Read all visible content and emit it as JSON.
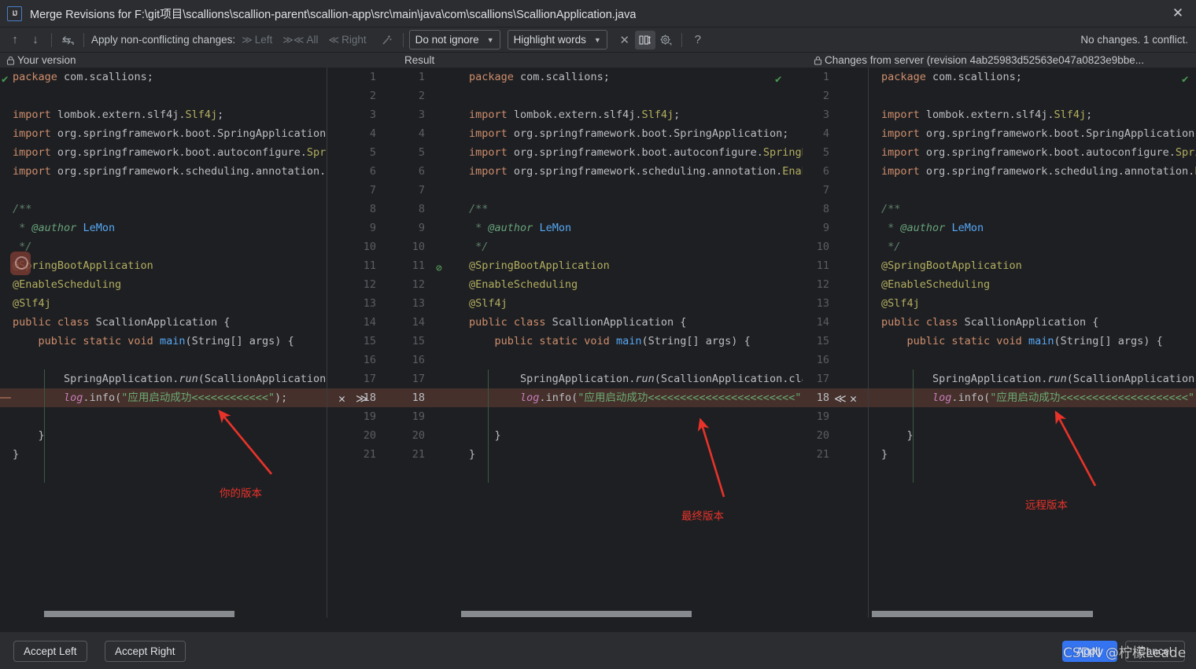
{
  "window": {
    "title": "Merge Revisions for F:\\git项目\\scallions\\scallion-parent\\scallion-app\\src\\main\\java\\com\\scallions\\ScallionApplication.java",
    "logo_text": "IJ",
    "close_icon": "✕"
  },
  "toolbar": {
    "prev_icon": "↑",
    "next_icon": "↓",
    "resolve_icon": "⇄",
    "apply_label": "Apply non-conflicting changes:",
    "left_label": "Left",
    "all_label": "All",
    "right_label": "Right",
    "magic_icon": "magic-wand",
    "ignore_policy": "Do not ignore",
    "highlight_policy": "Highlight words",
    "collapse_icon": "✕",
    "columns_icon": "columns",
    "settings_icon": "gear",
    "help_icon": "?",
    "caret": "▼",
    "status": "No changes. 1 conflict."
  },
  "panes": {
    "left_title": "Your version",
    "center_title": "Result",
    "right_title": "Changes from server (revision 4ab25983d52563e047a0823e9bbe...",
    "lock_glyph": "🔒"
  },
  "code": {
    "left_lines": [
      {
        "n": 1,
        "tokens": [
          [
            "kw",
            "package"
          ],
          [
            "id",
            " com.scallions"
          ],
          [
            "pun",
            ";"
          ]
        ]
      },
      {
        "n": 2,
        "tokens": []
      },
      {
        "n": 3,
        "tokens": [
          [
            "kw",
            "import"
          ],
          [
            "id",
            " lombok.extern.slf4j."
          ],
          [
            "ann",
            "Slf4j"
          ],
          [
            "pun",
            ";"
          ]
        ]
      },
      {
        "n": 4,
        "tokens": [
          [
            "kw",
            "import"
          ],
          [
            "id",
            " org.springframework.boot.SpringApplication"
          ],
          [
            "pun",
            ";"
          ]
        ]
      },
      {
        "n": 5,
        "tokens": [
          [
            "kw",
            "import"
          ],
          [
            "id",
            " org.springframework.boot.autoconfigure."
          ],
          [
            "ann",
            "Spri"
          ]
        ]
      },
      {
        "n": 6,
        "tokens": [
          [
            "kw",
            "import"
          ],
          [
            "id",
            " org.springframework.scheduling.annotation."
          ],
          [
            "ann",
            "E"
          ]
        ]
      },
      {
        "n": 7,
        "tokens": []
      },
      {
        "n": 8,
        "tokens": [
          [
            "doc",
            "/**"
          ]
        ]
      },
      {
        "n": 9,
        "tokens": [
          [
            "doc",
            " * "
          ],
          [
            "tag",
            "@author"
          ],
          [
            "doc",
            " "
          ],
          [
            "fn",
            "LeMon"
          ]
        ]
      },
      {
        "n": 10,
        "tokens": [
          [
            "doc",
            " */"
          ]
        ]
      },
      {
        "n": 11,
        "tokens": [
          [
            "ann",
            "@SpringBootApplication"
          ]
        ]
      },
      {
        "n": 12,
        "tokens": [
          [
            "ann",
            "@EnableScheduling"
          ]
        ]
      },
      {
        "n": 13,
        "tokens": [
          [
            "ann",
            "@Slf4j"
          ]
        ]
      },
      {
        "n": 14,
        "tokens": [
          [
            "kw",
            "public class "
          ],
          [
            "id",
            "ScallionApplication "
          ],
          [
            "brc",
            "{"
          ]
        ]
      },
      {
        "n": 15,
        "tokens": [
          [
            "id",
            "    "
          ],
          [
            "kw",
            "public static void "
          ],
          [
            "fn",
            "main"
          ],
          [
            "pun",
            "("
          ],
          [
            "id",
            "String"
          ],
          [
            "brc",
            "[]"
          ],
          [
            "id",
            " args"
          ],
          [
            "pun",
            ") "
          ],
          [
            "brc",
            "{"
          ]
        ]
      },
      {
        "n": 16,
        "tokens": []
      },
      {
        "n": 17,
        "tokens": [
          [
            "id",
            "        SpringApplication."
          ],
          [
            "mth",
            "run"
          ],
          [
            "pun",
            "("
          ],
          [
            "id",
            "ScallionApplication."
          ]
        ]
      },
      {
        "n": 18,
        "tokens": [
          [
            "id",
            "        "
          ],
          [
            "fld",
            "log"
          ],
          [
            "pun",
            "."
          ],
          [
            "id",
            "info"
          ],
          [
            "pun",
            "("
          ],
          [
            "str",
            "\"应用启动成功<<<<<<<<<<<<\""
          ],
          [
            "pun",
            ");"
          ]
        ],
        "conflict": true
      },
      {
        "n": 19,
        "tokens": []
      },
      {
        "n": 20,
        "tokens": [
          [
            "id",
            "    "
          ],
          [
            "brc",
            "}"
          ]
        ]
      },
      {
        "n": 21,
        "tokens": [
          [
            "brc",
            "}"
          ]
        ]
      }
    ],
    "center_lines": [
      {
        "n": 1,
        "tokens": [
          [
            "kw",
            "package"
          ],
          [
            "id",
            " com.scallions"
          ],
          [
            "pun",
            ";"
          ]
        ]
      },
      {
        "n": 2,
        "tokens": []
      },
      {
        "n": 3,
        "tokens": [
          [
            "kw",
            "import"
          ],
          [
            "id",
            " lombok.extern.slf4j."
          ],
          [
            "ann",
            "Slf4j"
          ],
          [
            "pun",
            ";"
          ]
        ]
      },
      {
        "n": 4,
        "tokens": [
          [
            "kw",
            "import"
          ],
          [
            "id",
            " org.springframework.boot.SpringApplication"
          ],
          [
            "pun",
            ";"
          ]
        ]
      },
      {
        "n": 5,
        "tokens": [
          [
            "kw",
            "import"
          ],
          [
            "id",
            " org.springframework.boot.autoconfigure."
          ],
          [
            "ann",
            "SpringB"
          ]
        ]
      },
      {
        "n": 6,
        "tokens": [
          [
            "kw",
            "import"
          ],
          [
            "id",
            " org.springframework.scheduling.annotation."
          ],
          [
            "ann",
            "Enab"
          ]
        ]
      },
      {
        "n": 7,
        "tokens": []
      },
      {
        "n": 8,
        "tokens": [
          [
            "doc",
            "/**"
          ]
        ]
      },
      {
        "n": 9,
        "tokens": [
          [
            "doc",
            " * "
          ],
          [
            "tag",
            "@author"
          ],
          [
            "doc",
            " "
          ],
          [
            "fn",
            "LeMon"
          ]
        ]
      },
      {
        "n": 10,
        "tokens": [
          [
            "doc",
            " */"
          ]
        ]
      },
      {
        "n": 11,
        "tokens": [
          [
            "ann",
            "@SpringBootApplication"
          ]
        ]
      },
      {
        "n": 12,
        "tokens": [
          [
            "ann",
            "@EnableScheduling"
          ]
        ]
      },
      {
        "n": 13,
        "tokens": [
          [
            "ann",
            "@Slf4j"
          ]
        ]
      },
      {
        "n": 14,
        "tokens": [
          [
            "kw",
            "public class "
          ],
          [
            "id",
            "ScallionApplication "
          ],
          [
            "brc",
            "{"
          ]
        ]
      },
      {
        "n": 15,
        "tokens": [
          [
            "id",
            "    "
          ],
          [
            "kw",
            "public static void "
          ],
          [
            "fn",
            "main"
          ],
          [
            "pun",
            "("
          ],
          [
            "id",
            "String"
          ],
          [
            "brc",
            "[]"
          ],
          [
            "id",
            " args"
          ],
          [
            "pun",
            ") "
          ],
          [
            "brc",
            "{"
          ]
        ]
      },
      {
        "n": 16,
        "tokens": []
      },
      {
        "n": 17,
        "tokens": [
          [
            "id",
            "        SpringApplication."
          ],
          [
            "mth",
            "run"
          ],
          [
            "pun",
            "("
          ],
          [
            "id",
            "ScallionApplication.cla"
          ]
        ]
      },
      {
        "n": 18,
        "tokens": [
          [
            "id",
            "        "
          ],
          [
            "fld",
            "log"
          ],
          [
            "pun",
            "."
          ],
          [
            "id",
            "info"
          ],
          [
            "pun",
            "("
          ],
          [
            "str",
            "\"应用启动成功<<<<<<<<<<<<<<<<<<<<<<<\""
          ]
        ],
        "conflict": true
      },
      {
        "n": 19,
        "tokens": []
      },
      {
        "n": 20,
        "tokens": [
          [
            "id",
            "    "
          ],
          [
            "brc",
            "}"
          ]
        ]
      },
      {
        "n": 21,
        "tokens": [
          [
            "brc",
            "}"
          ]
        ]
      }
    ],
    "right_lines": [
      {
        "n": 1,
        "tokens": [
          [
            "kw",
            "package"
          ],
          [
            "id",
            " com.scallions"
          ],
          [
            "pun",
            ";"
          ]
        ]
      },
      {
        "n": 2,
        "tokens": []
      },
      {
        "n": 3,
        "tokens": [
          [
            "kw",
            "import"
          ],
          [
            "id",
            " lombok.extern.slf4j."
          ],
          [
            "ann",
            "Slf4j"
          ],
          [
            "pun",
            ";"
          ]
        ]
      },
      {
        "n": 4,
        "tokens": [
          [
            "kw",
            "import"
          ],
          [
            "id",
            " org.springframework.boot.SpringApplication"
          ],
          [
            "pun",
            ";"
          ]
        ]
      },
      {
        "n": 5,
        "tokens": [
          [
            "kw",
            "import"
          ],
          [
            "id",
            " org.springframework.boot.autoconfigure."
          ],
          [
            "ann",
            "Spring"
          ]
        ]
      },
      {
        "n": 6,
        "tokens": [
          [
            "kw",
            "import"
          ],
          [
            "id",
            " org.springframework.scheduling.annotation."
          ],
          [
            "ann",
            "Ena"
          ]
        ]
      },
      {
        "n": 7,
        "tokens": []
      },
      {
        "n": 8,
        "tokens": [
          [
            "doc",
            "/**"
          ]
        ]
      },
      {
        "n": 9,
        "tokens": [
          [
            "doc",
            " * "
          ],
          [
            "tag",
            "@author"
          ],
          [
            "doc",
            " "
          ],
          [
            "fn",
            "LeMon"
          ]
        ]
      },
      {
        "n": 10,
        "tokens": [
          [
            "doc",
            " */"
          ]
        ]
      },
      {
        "n": 11,
        "tokens": [
          [
            "ann",
            "@SpringBootApplication"
          ]
        ]
      },
      {
        "n": 12,
        "tokens": [
          [
            "ann",
            "@EnableScheduling"
          ]
        ]
      },
      {
        "n": 13,
        "tokens": [
          [
            "ann",
            "@Slf4j"
          ]
        ]
      },
      {
        "n": 14,
        "tokens": [
          [
            "kw",
            "public class "
          ],
          [
            "id",
            "ScallionApplication "
          ],
          [
            "brc",
            "{"
          ]
        ]
      },
      {
        "n": 15,
        "tokens": [
          [
            "id",
            "    "
          ],
          [
            "kw",
            "public static void "
          ],
          [
            "fn",
            "main"
          ],
          [
            "pun",
            "("
          ],
          [
            "id",
            "String"
          ],
          [
            "brc",
            "[]"
          ],
          [
            "id",
            " args"
          ],
          [
            "pun",
            ") "
          ],
          [
            "brc",
            "{"
          ]
        ]
      },
      {
        "n": 16,
        "tokens": []
      },
      {
        "n": 17,
        "tokens": [
          [
            "id",
            "        SpringApplication."
          ],
          [
            "mth",
            "run"
          ],
          [
            "pun",
            "("
          ],
          [
            "id",
            "ScallionApplication.cl"
          ]
        ]
      },
      {
        "n": 18,
        "tokens": [
          [
            "id",
            "        "
          ],
          [
            "fld",
            "log"
          ],
          [
            "pun",
            "."
          ],
          [
            "id",
            "info"
          ],
          [
            "pun",
            "("
          ],
          [
            "str",
            "\"应用启动成功<<<<<<<<<<<<<<<<<<<<\""
          ],
          [
            "pun",
            ");"
          ]
        ],
        "conflict": true
      },
      {
        "n": 19,
        "tokens": []
      },
      {
        "n": 20,
        "tokens": [
          [
            "id",
            "    "
          ],
          [
            "brc",
            "}"
          ]
        ]
      },
      {
        "n": 21,
        "tokens": [
          [
            "brc",
            "}"
          ]
        ]
      }
    ]
  },
  "conflict": {
    "line_number": "18",
    "left_accept_icon": "✕",
    "left_apply_icon": "≫",
    "right_apply_icon": "≪",
    "right_accept_icon": "✕",
    "ok_check": "✔",
    "block_icon": "⊘"
  },
  "annotations": {
    "left": "你的版本",
    "center": "最终版本",
    "right": "远程版本",
    "color": "#e8332a"
  },
  "buttons": {
    "accept_left": "Accept Left",
    "accept_right": "Accept Right",
    "apply": "Apply",
    "cancel": "Cancel"
  },
  "watermark": "CSDN @柠檬Leade"
}
